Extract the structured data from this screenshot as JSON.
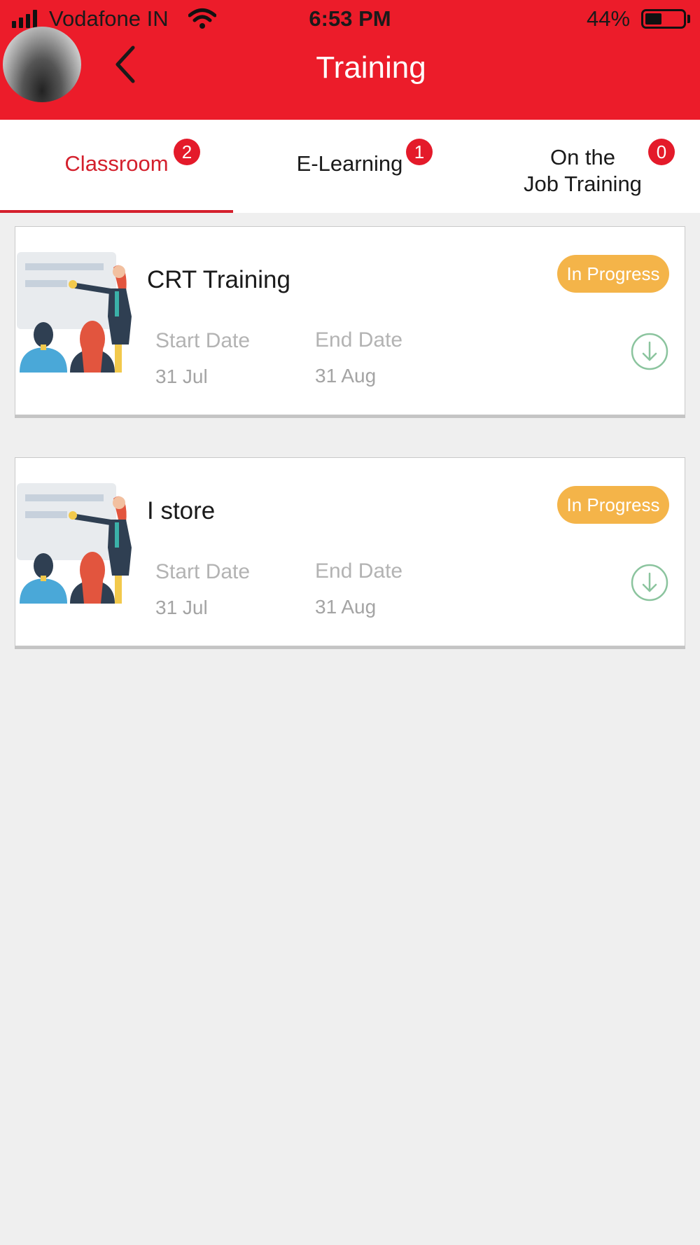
{
  "status_bar": {
    "carrier": "Vodafone IN",
    "time": "6:53 PM",
    "battery_percent": "44%",
    "battery_level": 0.44,
    "signal_bars": 4,
    "icons": [
      "signal-icon",
      "wifi-icon",
      "battery-icon"
    ]
  },
  "header": {
    "title": "Training",
    "background_color": "#ec1c2a",
    "icons": [
      "avatar",
      "back-arrow-icon"
    ]
  },
  "tabs": [
    {
      "label": "Classroom",
      "badge": "2",
      "active": true
    },
    {
      "label": "E-Learning",
      "badge": "1",
      "active": false
    },
    {
      "label_line1": "On the",
      "label_line2": "Job Training",
      "badge": "0",
      "active": false
    }
  ],
  "accent_color": "#d4202d",
  "status_color": "#f4b449",
  "trainings": [
    {
      "title": "CRT Training",
      "status": "In Progress",
      "start_label": "Start Date",
      "start_value": "31 Jul",
      "end_label": "End Date",
      "end_value": "31 Aug",
      "icons": [
        "classroom-illustration",
        "download-icon"
      ]
    },
    {
      "title": "I store",
      "status": "In Progress",
      "start_label": "Start Date",
      "start_value": "31 Jul",
      "end_label": "End Date",
      "end_value": "31 Aug",
      "icons": [
        "classroom-illustration",
        "download-icon"
      ]
    }
  ]
}
